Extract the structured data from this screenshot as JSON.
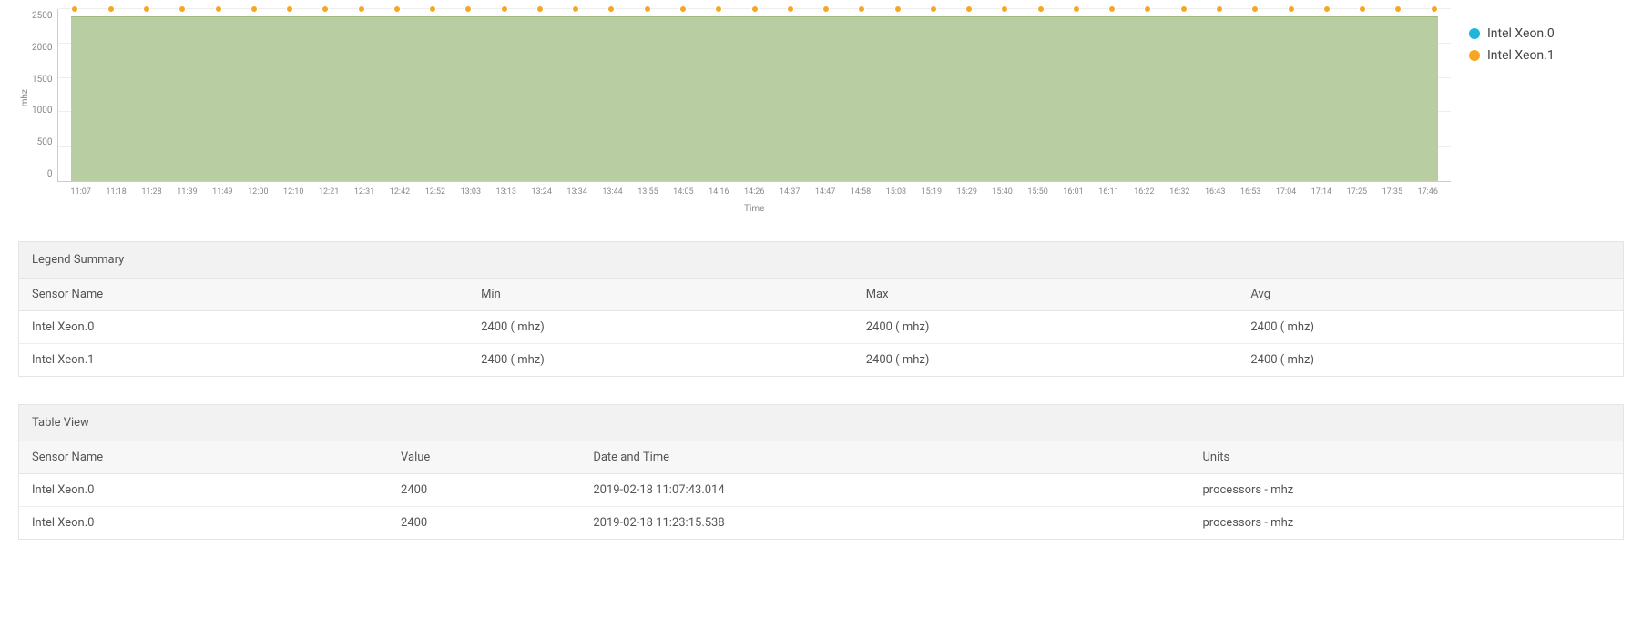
{
  "chart_data": {
    "type": "area",
    "xlabel": "Time",
    "ylabel": "mhz",
    "ylim": [
      0,
      2500
    ],
    "yticks": [
      0,
      500,
      1000,
      1500,
      2000,
      2500
    ],
    "x": [
      "11:07",
      "11:18",
      "11:28",
      "11:39",
      "11:49",
      "12:00",
      "12:10",
      "12:21",
      "12:31",
      "12:42",
      "12:52",
      "13:03",
      "13:13",
      "13:24",
      "13:34",
      "13:44",
      "13:55",
      "14:05",
      "14:16",
      "14:26",
      "14:37",
      "14:47",
      "14:58",
      "15:08",
      "15:19",
      "15:29",
      "15:40",
      "15:50",
      "16:01",
      "16:11",
      "16:22",
      "16:32",
      "16:43",
      "16:53",
      "17:04",
      "17:14",
      "17:25",
      "17:35",
      "17:46"
    ],
    "series": [
      {
        "name": "Intel Xeon.0",
        "color": "#1fb6d9",
        "values": [
          2400,
          2400,
          2400,
          2400,
          2400,
          2400,
          2400,
          2400,
          2400,
          2400,
          2400,
          2400,
          2400,
          2400,
          2400,
          2400,
          2400,
          2400,
          2400,
          2400,
          2400,
          2400,
          2400,
          2400,
          2400,
          2400,
          2400,
          2400,
          2400,
          2400,
          2400,
          2400,
          2400,
          2400,
          2400,
          2400,
          2400,
          2400,
          2400
        ]
      },
      {
        "name": "Intel Xeon.1",
        "color": "#f5a623",
        "values": [
          2400,
          2400,
          2400,
          2400,
          2400,
          2400,
          2400,
          2400,
          2400,
          2400,
          2400,
          2400,
          2400,
          2400,
          2400,
          2400,
          2400,
          2400,
          2400,
          2400,
          2400,
          2400,
          2400,
          2400,
          2400,
          2400,
          2400,
          2400,
          2400,
          2400,
          2400,
          2400,
          2400,
          2400,
          2400,
          2400,
          2400,
          2400,
          2400
        ]
      }
    ]
  },
  "legend_summary": {
    "title": "Legend Summary",
    "headers": {
      "sensor": "Sensor Name",
      "min": "Min",
      "max": "Max",
      "avg": "Avg"
    },
    "rows": [
      {
        "sensor": "Intel Xeon.0",
        "min": "2400 ( mhz)",
        "max": "2400 ( mhz)",
        "avg": "2400 ( mhz)"
      },
      {
        "sensor": "Intel Xeon.1",
        "min": "2400 ( mhz)",
        "max": "2400 ( mhz)",
        "avg": "2400 ( mhz)"
      }
    ]
  },
  "table_view": {
    "title": "Table View",
    "headers": {
      "sensor": "Sensor Name",
      "value": "Value",
      "datetime": "Date and Time",
      "units": "Units"
    },
    "rows": [
      {
        "sensor": "Intel Xeon.0",
        "value": "2400",
        "datetime": "2019-02-18 11:07:43.014",
        "units": "processors - mhz"
      },
      {
        "sensor": "Intel Xeon.0",
        "value": "2400",
        "datetime": "2019-02-18 11:23:15.538",
        "units": "processors - mhz"
      }
    ]
  }
}
